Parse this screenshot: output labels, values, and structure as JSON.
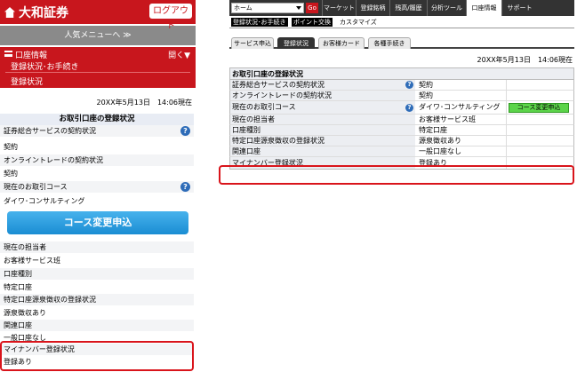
{
  "mobile": {
    "brand": "大和証券",
    "logout_label": "ログアウト",
    "popular_menu": "人気メニューへ ≫",
    "menu": {
      "title": "口座情報",
      "open_label": "開く▼",
      "subtitle": "登録状況･お手続き",
      "current": "登録状況"
    },
    "datetime": "20XX年5月13日　14:06現在",
    "section_title": "お取引口座の登録状況",
    "rows": [
      "証券総合サービスの契約状況",
      "契約",
      "オンライントレードの契約状況",
      "契約",
      "現在のお取引コース",
      "ダイワ･コンサルティング"
    ],
    "course_button": "コース変更申込",
    "rows2": [
      "現在の担当者",
      "お客様サービス班",
      "口座種別",
      "特定口座",
      "特定口座源泉徴収の登録状況",
      "源泉徴収あり",
      "関連口座",
      "一般口座なし",
      "マイナンバー登録状況",
      "登録あり"
    ]
  },
  "pc": {
    "home_select": "ホーム",
    "go": "Go",
    "nav": [
      "マーケット",
      "登録銘柄",
      "残高/履歴",
      "分析ツール",
      "口座情報",
      "サポート"
    ],
    "subnav": [
      "登録状況･お手続き",
      "ポイント交換",
      "カスタマイズ"
    ],
    "tabs": [
      "サービス申込",
      "登録状況",
      "お客様カード",
      "各種手続き"
    ],
    "datetime": "20XX年5月13日　14:06現在",
    "section_title": "お取引口座の登録状況",
    "rows": [
      {
        "label": "証券総合サービスの契約状況",
        "value": "契約"
      },
      {
        "label": "オンライントレードの契約状況",
        "value": "契約"
      },
      {
        "label": "現在のお取引コース",
        "value": "ダイワ･コンサルティング",
        "button": "コース変更申込"
      },
      {
        "label": "現在の担当者",
        "value": "お客様サービス班"
      },
      {
        "label": "口座種別",
        "value": "特定口座"
      },
      {
        "label": "特定口座源泉徴収の登録状況",
        "value": "源泉徴収あり"
      },
      {
        "label": "関連口座",
        "value": "一般口座なし"
      },
      {
        "label": "マイナンバー登録状況",
        "value": "登録あり"
      }
    ]
  },
  "colors": {
    "brand_red": "#c8161d",
    "highlight": "#d9141b",
    "help_blue": "#2e6cb8",
    "button_green": "#5cd44a"
  }
}
